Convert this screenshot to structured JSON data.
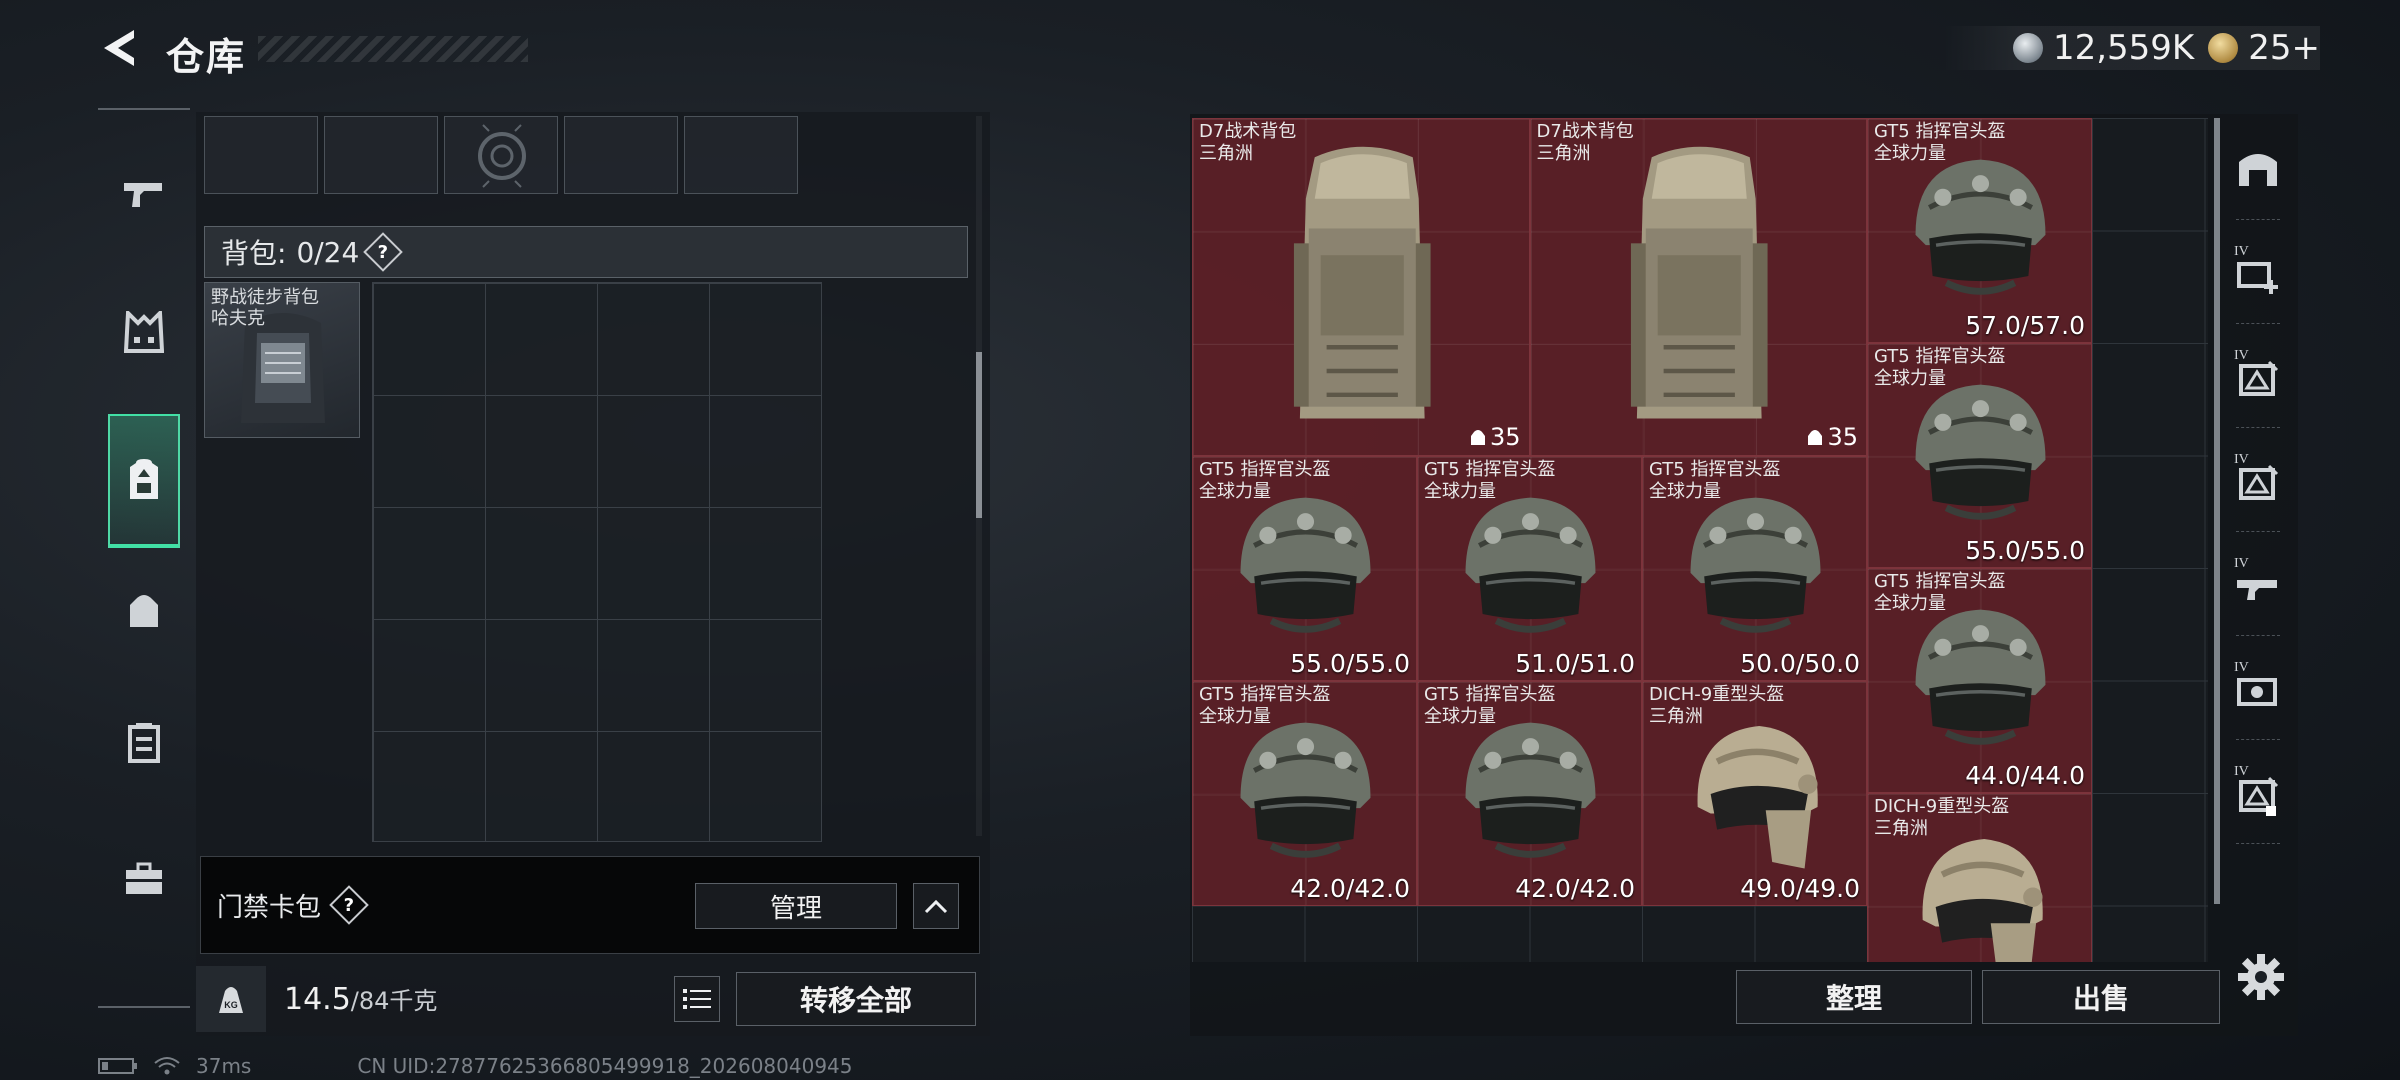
{
  "header": {
    "title": "仓库",
    "currency": [
      {
        "icon": "silver-coin-icon",
        "value": "12,559K"
      },
      {
        "icon": "gold-coin-icon",
        "value": "25+"
      }
    ]
  },
  "left_nav": {
    "items": [
      {
        "name": "weapon-tab",
        "icon": "pistol-icon"
      },
      {
        "name": "armor-tab",
        "icon": "vest-icon"
      },
      {
        "name": "backpack-storage-tab",
        "icon": "backpack-icon",
        "active": true
      },
      {
        "name": "bag-tab",
        "icon": "small-bag-icon"
      },
      {
        "name": "chest-rig-tab",
        "icon": "chest-rig-icon"
      },
      {
        "name": "case-tab",
        "icon": "briefcase-icon"
      }
    ]
  },
  "backpack": {
    "label": "背包:",
    "count": "0/24",
    "help": "?",
    "container_name_line1": "野战徒步背包",
    "container_name_line2": "哈夫克"
  },
  "keycard": {
    "label": "门禁卡包",
    "help": "?",
    "manage_label": "管理"
  },
  "weight": {
    "icon_label": "KG",
    "current": "14.5",
    "capacity": "/84千克",
    "transfer_label": "转移全部"
  },
  "stash": {
    "items": [
      {
        "line1": "D7战术背包",
        "line2": "三角洲",
        "value": "35",
        "kind": "backpack"
      },
      {
        "line1": "D7战术背包",
        "line2": "三角洲",
        "value": "35",
        "kind": "backpack"
      },
      {
        "line1": "GT5 指挥官头盔",
        "line2": "全球力量",
        "value": "57.0/57.0",
        "kind": "helmet"
      },
      {
        "line1": "GT5 指挥官头盔",
        "line2": "全球力量",
        "value": "55.0/55.0",
        "kind": "helmet"
      },
      {
        "line1": "GT5 指挥官头盔",
        "line2": "全球力量",
        "value": "55.0/55.0",
        "kind": "helmet"
      },
      {
        "line1": "GT5 指挥官头盔",
        "line2": "全球力量",
        "value": "51.0/51.0",
        "kind": "helmet"
      },
      {
        "line1": "GT5 指挥官头盔",
        "line2": "全球力量",
        "value": "50.0/50.0",
        "kind": "helmet"
      },
      {
        "line1": "GT5 指挥官头盔",
        "line2": "全球力量",
        "value": "44.0/44.0",
        "kind": "helmet"
      },
      {
        "line1": "GT5 指挥官头盔",
        "line2": "全球力量",
        "value": "42.0/42.0",
        "kind": "helmet"
      },
      {
        "line1": "GT5 指挥官头盔",
        "line2": "全球力量",
        "value": "42.0/42.0",
        "kind": "helmet"
      },
      {
        "line1": "DICH-9重型头盔",
        "line2": "三角洲",
        "value": "49.0/49.0",
        "kind": "heavy-helmet"
      },
      {
        "line1": "DICH-9重型头盔",
        "line2": "三角洲",
        "value": "",
        "kind": "heavy-helmet"
      }
    ],
    "sort_label": "整理",
    "sell_label": "出售"
  },
  "right_nav": {
    "items": [
      {
        "name": "stash-home-tab",
        "icon": "arch-icon"
      },
      {
        "name": "stash-add-tab",
        "icon": "add-stash-icon",
        "badge": "IV"
      },
      {
        "name": "stash-page-2-tab",
        "icon": "triangle-stash-icon",
        "badge": "IV"
      },
      {
        "name": "stash-page-3-tab",
        "icon": "triangle-stash-icon",
        "badge": "IV"
      },
      {
        "name": "stash-page-4-tab",
        "icon": "gun-stash-icon",
        "badge": "IV"
      },
      {
        "name": "stash-page-5-tab",
        "icon": "camera-stash-icon",
        "badge": "IV"
      },
      {
        "name": "stash-page-6-tab",
        "icon": "triangle-stash-icon",
        "badge": "IV",
        "active": true
      }
    ]
  },
  "status": {
    "ping": "37ms",
    "uid": "CN UID:27877625366805499918_202608040945"
  },
  "colors": {
    "accent": "#41e0a5",
    "item_bg": "#62202a"
  }
}
